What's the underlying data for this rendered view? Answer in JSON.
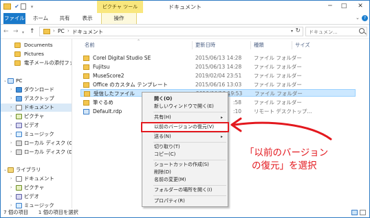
{
  "window": {
    "title": "ドキュメント",
    "contextual_tab_group": "ピクチャ ツール",
    "buttons": {
      "minimize": "─",
      "maximize": "□",
      "close": "✕"
    }
  },
  "ribbon": {
    "tabs": [
      "ファイル",
      "ホーム",
      "共有",
      "表示",
      "操作"
    ],
    "help": "?"
  },
  "address": {
    "crumbs": [
      "PC",
      "ドキュメント"
    ],
    "search_placeholder": "ドキュメン..."
  },
  "nav": {
    "items": [
      {
        "label": "Documents",
        "icon": "folder-icon"
      },
      {
        "label": "Pictures",
        "icon": "folder-icon"
      },
      {
        "label": "電子メールの添付ファ",
        "icon": "folder-icon"
      },
      {
        "label": "PC",
        "icon": "pc-icon"
      },
      {
        "label": "ダウンロード",
        "icon": "download-icon"
      },
      {
        "label": "デスクトップ",
        "icon": "desktop-icon"
      },
      {
        "label": "ドキュメント",
        "icon": "documents-icon"
      },
      {
        "label": "ピクチャ",
        "icon": "pictures-icon"
      },
      {
        "label": "ビデオ",
        "icon": "videos-icon"
      },
      {
        "label": "ミュージック",
        "icon": "music-icon"
      },
      {
        "label": "ローカル ディスク (C:)",
        "icon": "drive-icon"
      },
      {
        "label": "ローカル ディスク (D:)",
        "icon": "drive-icon"
      },
      {
        "label": "ライブラリ",
        "icon": "library-icon"
      },
      {
        "label": "ドキュメント",
        "icon": "documents-icon"
      },
      {
        "label": "ピクチャ",
        "icon": "pictures-icon"
      },
      {
        "label": "ビデオ",
        "icon": "videos-icon"
      },
      {
        "label": "ミュージック",
        "icon": "music-icon"
      }
    ]
  },
  "columns": {
    "name": "名前",
    "date": "更新日時",
    "type": "種類",
    "size": "サイズ"
  },
  "files": [
    {
      "name": "Corel Digital Studio SE",
      "date": "2015/06/13 14:28",
      "type": "ファイル フォルダー",
      "icon": "folder-icon"
    },
    {
      "name": "Fujitsu",
      "date": "2015/06/13 14:28",
      "type": "ファイル フォルダー",
      "icon": "folder-icon"
    },
    {
      "name": "MuseScore2",
      "date": "2019/02/04 23:51",
      "type": "ファイル フォルダー",
      "icon": "folder-icon"
    },
    {
      "name": "Office のカスタム テンプレート",
      "date": "2015/06/16 13:03",
      "type": "ファイル フォルダー",
      "icon": "folder-icon"
    },
    {
      "name": "受信したファイル",
      "date": "2019/06/18 19:53",
      "type": "ファイル フォルダー",
      "icon": "folder-icon"
    },
    {
      "name": "筆ぐるめ",
      "date": ":58",
      "type": "ファイル フォルダー",
      "icon": "folder-icon"
    },
    {
      "name": "Default.rdp",
      "date": ":10",
      "type": "リモート デスクトップ...",
      "icon": "rdp-file-icon"
    }
  ],
  "context_menu": [
    {
      "label": "開く(O)",
      "bold": true
    },
    {
      "label": "新しいウィンドウで開く(E)"
    },
    {
      "sep": true
    },
    {
      "label": "共有(H)",
      "submenu": true
    },
    {
      "sep": true
    },
    {
      "label": "以前のバージョンの復元(V)",
      "highlight": true
    },
    {
      "sep": true
    },
    {
      "label": "送る(N)",
      "submenu": true
    },
    {
      "sep": true
    },
    {
      "label": "切り取り(T)"
    },
    {
      "label": "コピー(C)"
    },
    {
      "sep": true
    },
    {
      "label": "ショートカットの作成(S)"
    },
    {
      "label": "削除(D)"
    },
    {
      "label": "名前の変更(M)"
    },
    {
      "sep": true
    },
    {
      "label": "フォルダーの場所を開く(I)"
    },
    {
      "sep": true
    },
    {
      "label": "プロパティ(R)"
    }
  ],
  "status": {
    "text": "7 個の項目　　1 個の項目を選択"
  },
  "annotation": {
    "line1": "「以前のバージョン",
    "line2": "の復元」を選択",
    "color": "#e3181e"
  }
}
